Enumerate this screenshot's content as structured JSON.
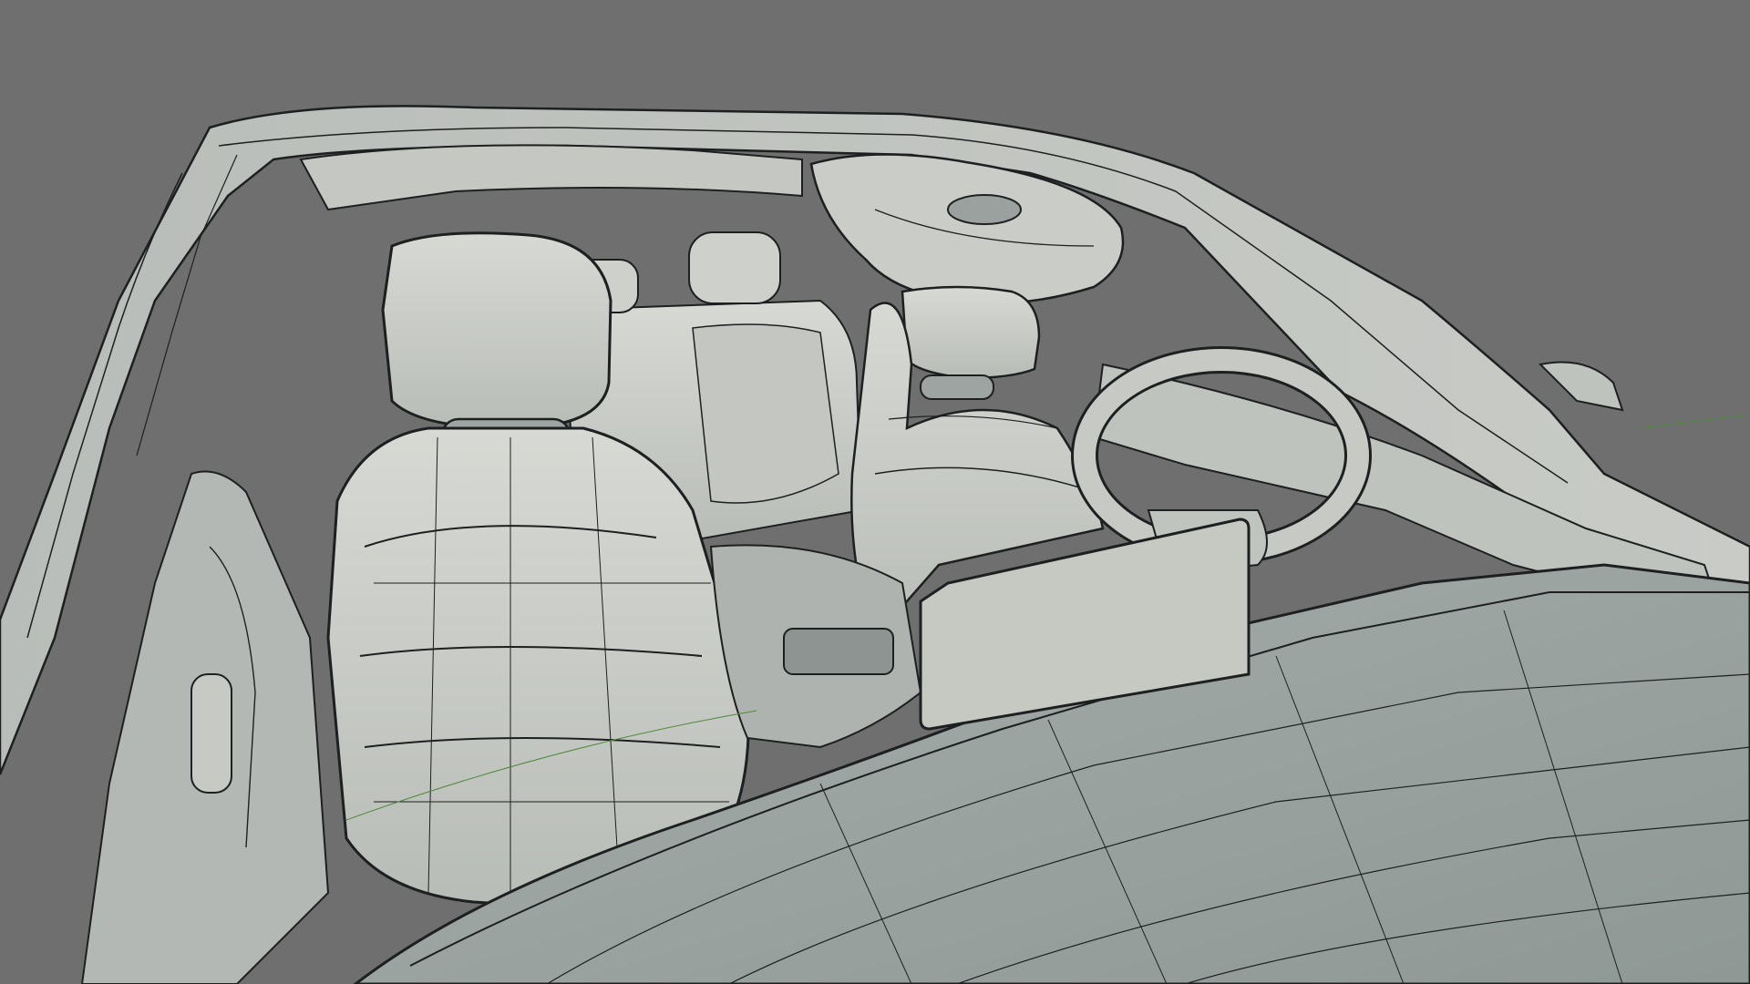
{
  "viewport": {
    "background_color": "#6f6f6f",
    "surface_color": "#c9ccc7",
    "shadow_color": "#8e9693",
    "wire_color": "#1d1f20",
    "axis_color": "#4f8a3a"
  },
  "scene": {
    "subject": "car-interior-wireframe-model",
    "parts": [
      "roof-frame",
      "windshield-frame",
      "rearview-mirror",
      "front-left-seat",
      "front-right-seat",
      "rear-seat",
      "rear-headrests",
      "steering-wheel",
      "infotainment-screen",
      "center-console",
      "dashboard",
      "door-panel-left",
      "side-mirror-right"
    ]
  }
}
